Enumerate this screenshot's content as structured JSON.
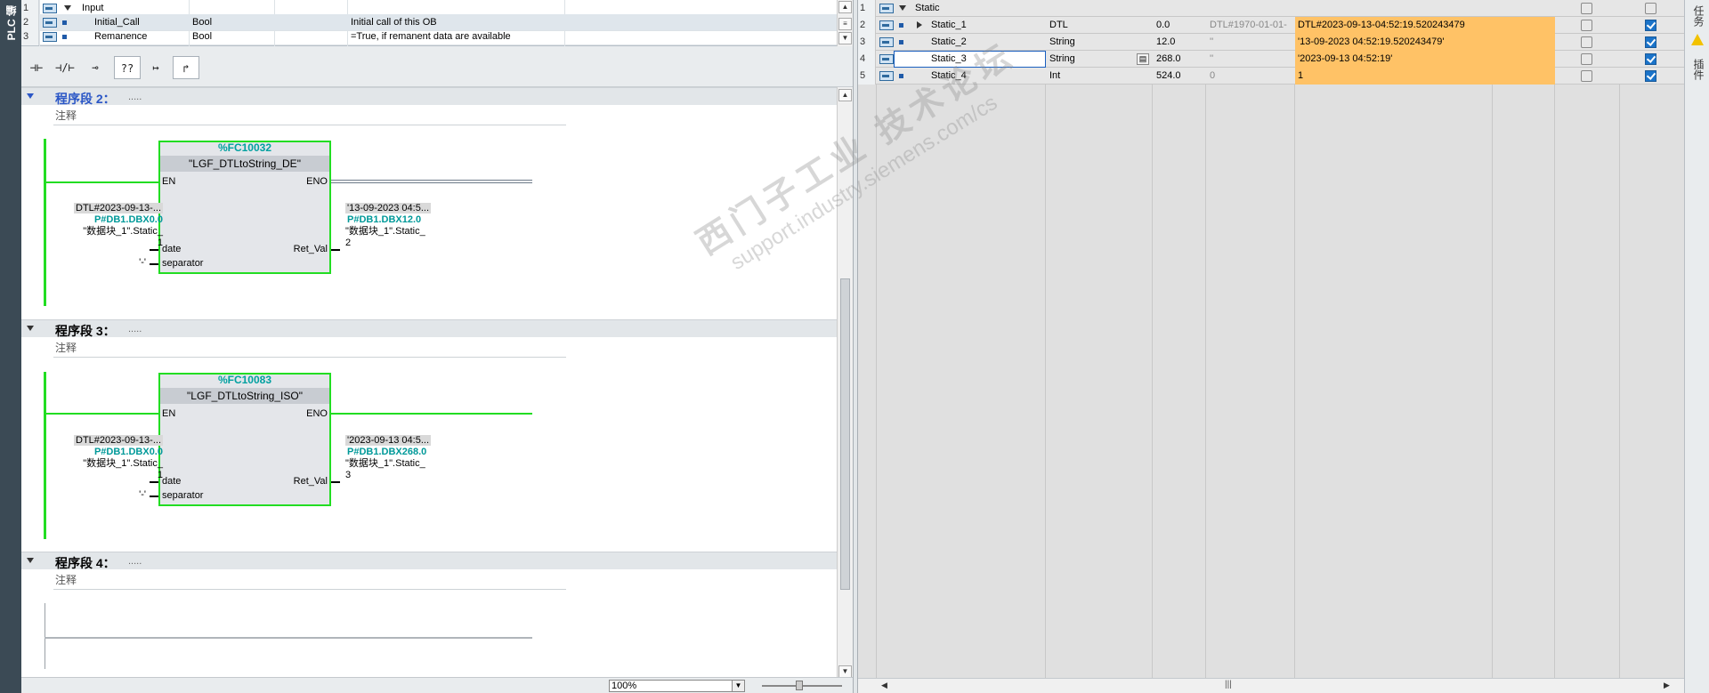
{
  "left_strip": {
    "label": "PLC 编"
  },
  "interface": {
    "rows": [
      {
        "num": "1",
        "name": "Input",
        "type": "",
        "comment": ""
      },
      {
        "num": "2",
        "name": "Initial_Call",
        "type": "Bool",
        "comment": "Initial call of this OB"
      },
      {
        "num": "3",
        "name": "Remanence",
        "type": "Bool",
        "comment": "=True, if remanent data are available"
      }
    ]
  },
  "toolbar": {
    "buttons": [
      "⊣⊢",
      "⊣/⊢",
      "⊸",
      "??",
      "↦",
      "↱"
    ]
  },
  "networks": [
    {
      "title": "程序段 2：",
      "dots": ".....",
      "comment": "注释",
      "fb_number": "%FC10032",
      "fb_name": "\"LGF_DTLtoString_DE\"",
      "pins": {
        "en": "EN",
        "eno": "ENO",
        "date": "date",
        "separator": "separator",
        "retval": "Ret_Val"
      },
      "in_date": {
        "value": "DTL#2023-09-13-...",
        "addr": "P#DB1.DBX0.0",
        "tag": "\"数据块_1\".Static_",
        "suffix": "1"
      },
      "in_sep": "'-'",
      "out": {
        "value": "'13-09-2023 04:5...",
        "addr": "P#DB1.DBX12.0",
        "tag": "\"数据块_1\".Static_",
        "suffix": "2"
      }
    },
    {
      "title": "程序段 3：",
      "dots": ".....",
      "comment": "注释",
      "fb_number": "%FC10083",
      "fb_name": "\"LGF_DTLtoString_ISO\"",
      "pins": {
        "en": "EN",
        "eno": "ENO",
        "date": "date",
        "separator": "separator",
        "retval": "Ret_Val"
      },
      "in_date": {
        "value": "DTL#2023-09-13-...",
        "addr": "P#DB1.DBX0.0",
        "tag": "\"数据块_1\".Static_",
        "suffix": "1"
      },
      "in_sep": "'-'",
      "out": {
        "value": "'2023-09-13 04:5...",
        "addr": "P#DB1.DBX268.0",
        "tag": "\"数据块_1\".Static_",
        "suffix": "3"
      }
    },
    {
      "title": "程序段 4：",
      "dots": ".....",
      "comment": "注释"
    }
  ],
  "status": {
    "zoom": "100%"
  },
  "db": {
    "rows": [
      {
        "num": "1",
        "name": "Static",
        "type": "",
        "offset": "",
        "start": "",
        "monitor": ""
      },
      {
        "num": "2",
        "name": "Static_1",
        "type": "DTL",
        "offset": "0.0",
        "start": "DTL#1970-01-01-",
        "monitor": "DTL#2023-09-13-04:52:19.520243479"
      },
      {
        "num": "3",
        "name": "Static_2",
        "type": "String",
        "offset": "12.0",
        "start": "''",
        "monitor": "'13-09-2023 04:52:19.520243479'"
      },
      {
        "num": "4",
        "name": "Static_3",
        "type": "String",
        "offset": "268.0",
        "start": "''",
        "monitor": "'2023-09-13 04:52:19'"
      },
      {
        "num": "5",
        "name": "Static_4",
        "type": "Int",
        "offset": "524.0",
        "start": "0",
        "monitor": "1"
      }
    ]
  },
  "right_strip": {
    "label1": "任务",
    "label2": "插件"
  },
  "watermark": {
    "line1": "西门子工业  技术论坛",
    "line2": "support.industry.siemens.com/cs"
  },
  "colors": {
    "monitor_bg": "#ffc266",
    "power_flow": "#22dd22",
    "address": "#009999"
  }
}
